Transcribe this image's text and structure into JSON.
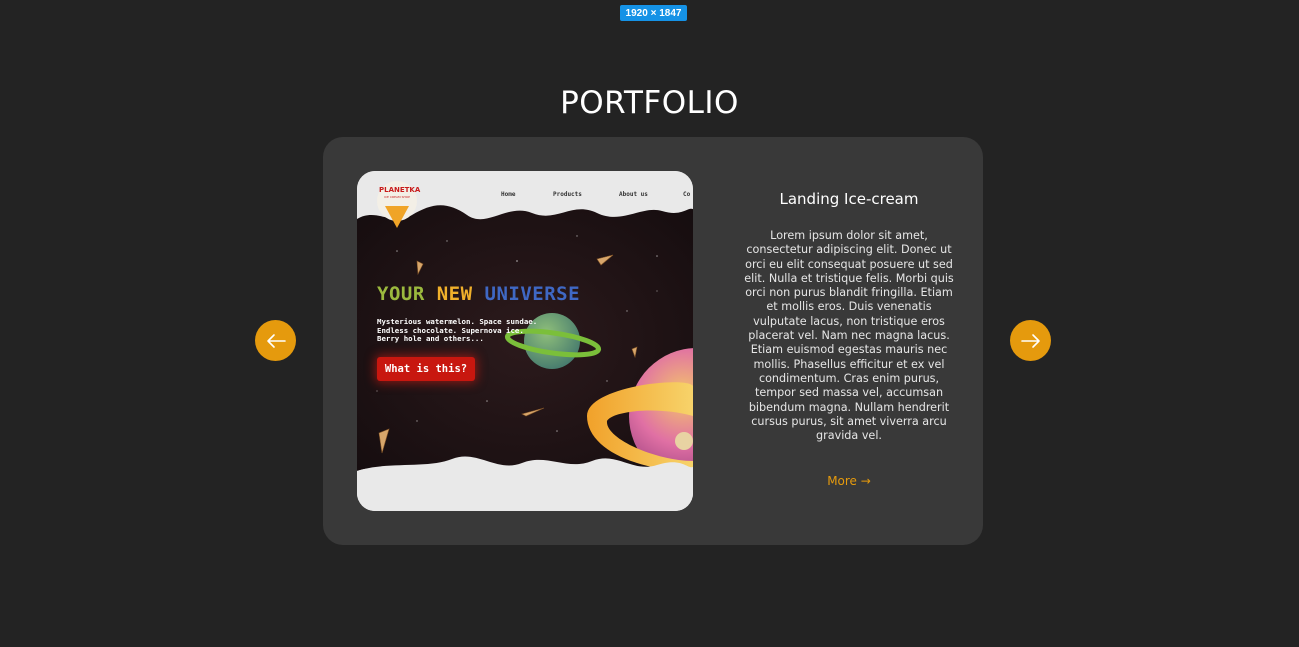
{
  "canvas_badge": "1920 × 1847",
  "section": {
    "title": "PORTFOLIO"
  },
  "colors": {
    "background": "#232323",
    "card": "#393939",
    "accent": "#e59a0d",
    "badge": "#1592e6"
  },
  "carousel": {
    "prev_icon": "arrow-left-icon",
    "next_icon": "arrow-right-icon"
  },
  "project": {
    "title": "Landing Ice-cream",
    "description": "Lorem ipsum dolor sit amet, consectetur adipiscing elit. Donec ut orci eu elit consequat posuere ut sed elit. Nulla et tristique felis. Morbi quis orci non purus blandit fringilla. Etiam et mollis eros. Duis venenatis vulputate lacus, non tristique eros placerat vel. Nam nec magna lacus. Etiam euismod egestas mauris nec mollis. Phasellus efficitur et ex vel condimentum. Cras enim purus, tempor sed massa vel, accumsan bibendum magna. Nullam hendrerit cursus purus, sit amet viverra arcu gravida vel.",
    "more_label": "More →",
    "preview": {
      "logo": "PLANETKA",
      "logo_sub": "ICE CREAM SHOP",
      "nav": [
        "Home",
        "Products",
        "About us",
        "Co"
      ],
      "headline": [
        "YOUR",
        "NEW",
        "UNIVERSE"
      ],
      "subtext": [
        "Mysterious watermelon. Space sundae.",
        "Endless chocolate. Supernova ice.",
        "Berry hole and others..."
      ],
      "cta": "What is this?"
    }
  }
}
